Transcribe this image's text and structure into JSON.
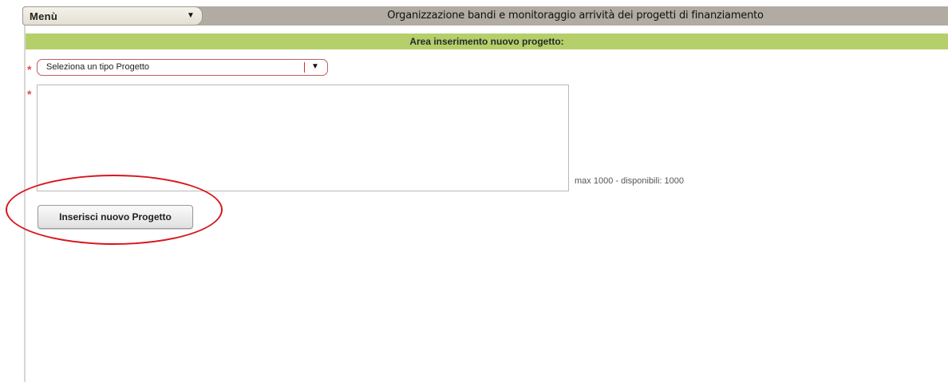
{
  "header": {
    "menu_label": "Menù",
    "menu_arrow_icon": "triangle-down-icon",
    "app_title": "Organizzazione bandi e monitoraggio arrività dei progetti di finanziamento"
  },
  "section": {
    "title": "Area inserimento nuovo progetto:",
    "accent_color": "#b5cf6b"
  },
  "form": {
    "required_marker": "*",
    "project_type": {
      "selected_value": "Seleziona un tipo Progetto",
      "arrow_icon": "triangle-down-icon"
    },
    "description": {
      "value": "",
      "counter_text": "max 1000 - disponibili:  1000"
    },
    "submit_label": "Inserisci nuovo Progetto"
  },
  "annotation": {
    "color": "#d8141b",
    "shape": "ellipse-highlight"
  }
}
